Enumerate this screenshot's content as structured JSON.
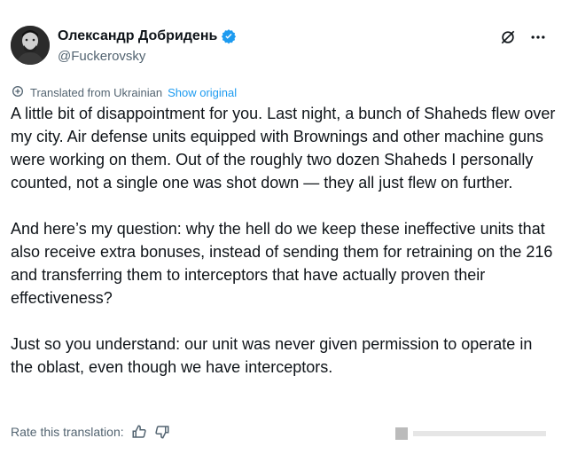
{
  "author": {
    "display_name": "Олександр Добридень",
    "handle": "@Fuckerovsky",
    "verified": true
  },
  "header": {
    "grok_icon": "grok-slash-icon",
    "more_icon": "more-dots-icon"
  },
  "translation": {
    "note": "Translated from Ukrainian",
    "show_original": "Show original"
  },
  "tweet": {
    "paragraphs": [
      "A little bit of disappointment for you. Last night, a bunch of Shaheds flew over my city. Air defense units equipped with Brownings and other machine guns were working on them. Out of the roughly two dozen Shaheds I personally counted, not a single one was shot down — they all just flew on further.",
      "And here’s my question: why the hell do we keep these ineffective units that also receive extra bonuses, instead of sending them for retraining on the 216 and transferring them to interceptors that have actually proven their effectiveness?",
      "Just so you understand: our unit was never given permission to operate in the oblast, even though we have interceptors."
    ]
  },
  "rate": {
    "label": "Rate this translation:"
  },
  "colors": {
    "text": "#0f1419",
    "secondary": "#536471",
    "accent": "#1d9bf0"
  }
}
